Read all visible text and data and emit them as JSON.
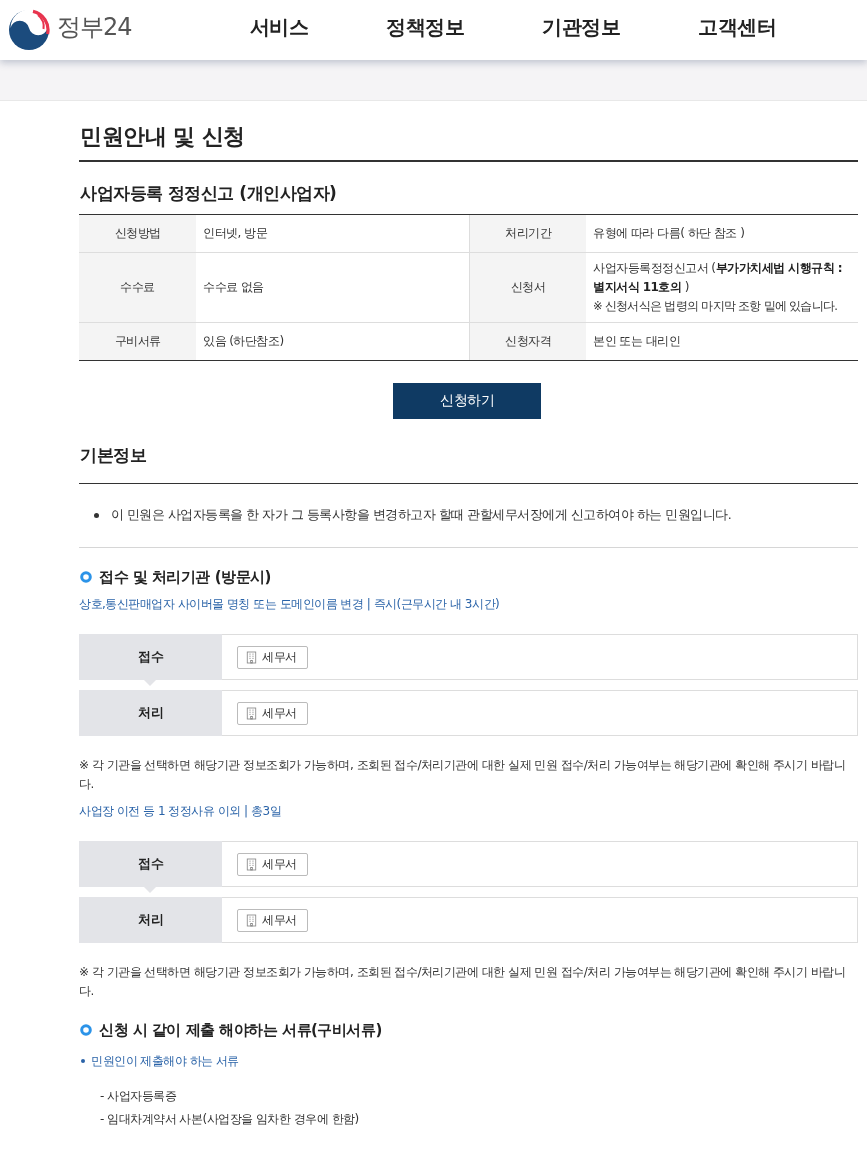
{
  "header": {
    "logo_text": "정부24",
    "nav": [
      "서비스",
      "정책정보",
      "기관정보",
      "고객센터"
    ]
  },
  "page_title": "민원안내 및 신청",
  "service": {
    "title": "사업자등록 정정신고 (개인사업자)",
    "info_rows": [
      [
        {
          "label": "신청방법",
          "value": "인터넷, 방문"
        },
        {
          "label": "처리기간",
          "value": "유형에 따라 다름( 하단 참조 )"
        }
      ],
      [
        {
          "label": "수수료",
          "value": "수수료 없음"
        },
        {
          "label": "신청서",
          "value": "사업자등록정정신고서 (**부가가치세법 시행규칙 : 별지서식 11호의** )",
          "note": "※ 신청서식은 법령의 마지막 조항 밑에 있습니다."
        }
      ],
      [
        {
          "label": "구비서류",
          "value": "있음 (하단참조)"
        },
        {
          "label": "신청자격",
          "value": "본인 또는 대리인"
        }
      ]
    ],
    "apply_button": "신청하기"
  },
  "basic_info": {
    "title": "기본정보",
    "bullets": [
      "이 민원은 사업자등록을 한 자가 그 등록사항을 변경하고자 할때 관할세무서장에게 신고하여야 하는 민원입니다."
    ]
  },
  "agencies": {
    "title": "접수 및 처리기관 (방문시)",
    "cases": [
      {
        "heading": "상호,통신판매업자 사이버몰 명칭 또는 도메인이름 변경 | 즉시(근무시간 내 3시간)",
        "steps": [
          {
            "label": "접수",
            "office": "세무서"
          },
          {
            "label": "처리",
            "office": "세무서"
          }
        ],
        "note": "※ 각 기관을 선택하면 해당기관 정보조회가 가능하며, 조회된 접수/처리기관에 대한 실제 민원 접수/처리 가능여부는 해당기관에 확인해 주시기 바랍니다."
      },
      {
        "heading": "사업장 이전 등 1 정정사유 이외 | 총3일",
        "steps": [
          {
            "label": "접수",
            "office": "세무서"
          },
          {
            "label": "처리",
            "office": "세무서"
          }
        ],
        "note": "※ 각 기관을 선택하면 해당기관 정보조회가 가능하며, 조회된 접수/처리기관에 대한 실제 민원 접수/처리 가능여부는 해당기관에 확인해 주시기 바랍니다."
      }
    ]
  },
  "documents": {
    "title": "신청 시 같이 제출 해야하는 서류(구비서류)",
    "groups": [
      {
        "heading": "민원인이 제출해야 하는 서류",
        "items": [
          "- 사업자등록증",
          "- 임대차계약서 사본(사업장을 임차한 경우에 한함)"
        ]
      }
    ]
  }
}
